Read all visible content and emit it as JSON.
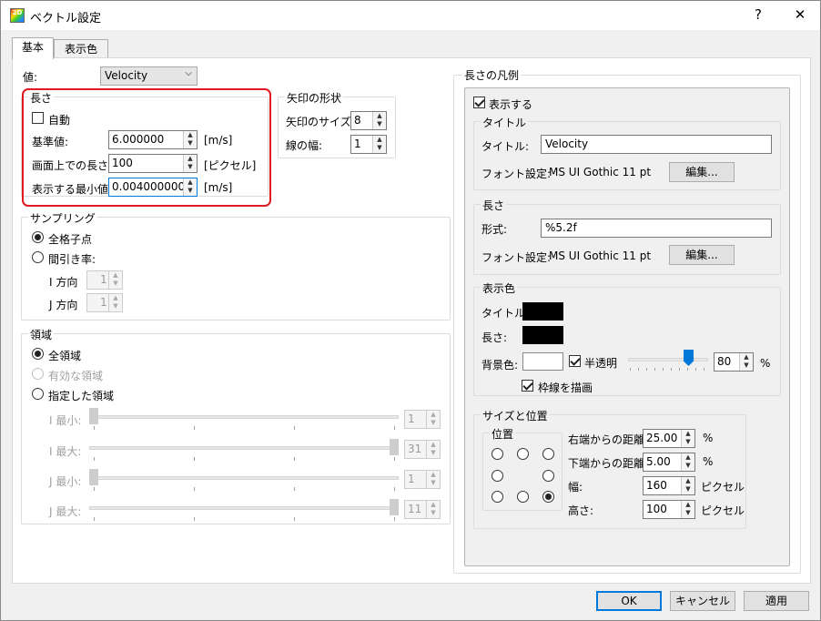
{
  "window": {
    "title": "ベクトル設定",
    "help": "?",
    "close": "✕",
    "icon_text": "2D"
  },
  "tabs": [
    {
      "label": "基本"
    },
    {
      "label": "表示色"
    }
  ],
  "value": {
    "label": "値:",
    "selected": "Velocity"
  },
  "length": {
    "group": "長さ",
    "auto": "自動",
    "base_label": "基準値:",
    "base_value": "6.000000",
    "base_unit": "[m/s]",
    "screen_label": "画面上での長さ:",
    "screen_value": "100",
    "screen_unit": "[ピクセル]",
    "min_label": "表示する最小値:",
    "min_value": "0.004000000",
    "min_unit": "[m/s]"
  },
  "arrow": {
    "group": "矢印の形状",
    "size_label": "矢印のサイズ:",
    "size_value": "8",
    "width_label": "線の幅:",
    "width_value": "1"
  },
  "sampling": {
    "group": "サンプリング",
    "all": "全格子点",
    "thin": "間引き率:",
    "i_label": "I 方向",
    "i_value": "1",
    "j_label": "J 方向",
    "j_value": "1"
  },
  "region": {
    "group": "領域",
    "all": "全領域",
    "valid": "有効な領域",
    "specified": "指定した領域",
    "imin_label": "I 最小:",
    "imin_value": "1",
    "imax_label": "I 最大:",
    "imax_value": "31",
    "jmin_label": "J 最小:",
    "jmin_value": "1",
    "jmax_label": "J 最大:",
    "jmax_value": "11"
  },
  "legend": {
    "group": "長さの凡例",
    "show": "表示する",
    "title_group": "タイトル",
    "title_label": "タイトル:",
    "title_value": "Velocity",
    "font_label": "フォント設定:",
    "font_value": "MS  UI Gothic 11  pt",
    "edit": "編集...",
    "length_group": "長さ",
    "format_label": "形式:",
    "format_value": "%5.2f",
    "font2_label": "フォント設定:",
    "font2_value": "MS  UI Gothic 11  pt",
    "edit2": "編集...",
    "color_group": "表示色",
    "c_title": "タイトル:",
    "c_length": "長さ:",
    "c_bg": "背景色:",
    "semi": "半透明",
    "opacity_value": "80",
    "percent": "%",
    "border": "枠線を描画",
    "pos_group": "サイズと位置",
    "position": "位置",
    "right_label": "右端からの距離",
    "right_value": "25.00",
    "right_unit": "%",
    "bottom_label": "下端からの距離",
    "bottom_value": "5.00",
    "bottom_unit": "%",
    "w_label": "幅:",
    "w_value": "160",
    "w_unit": "ピクセル",
    "h_label": "高さ:",
    "h_value": "100",
    "h_unit": "ピクセル"
  },
  "footer": {
    "ok": "OK",
    "cancel": "キャンセル",
    "apply": "適用"
  }
}
